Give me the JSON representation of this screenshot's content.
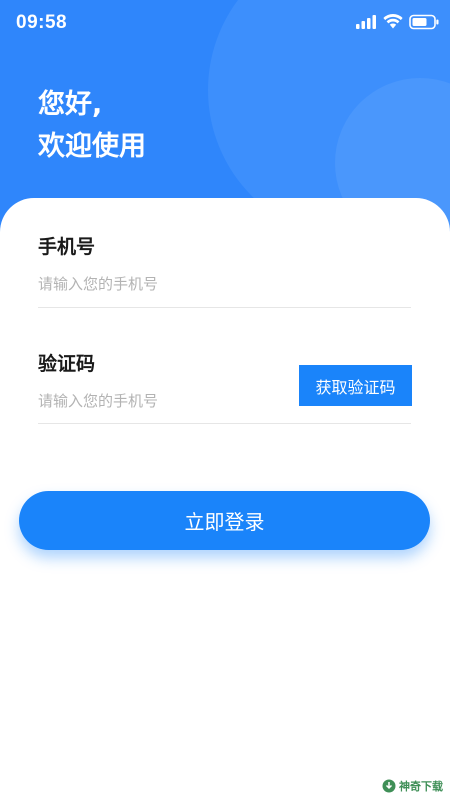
{
  "status_bar": {
    "time": "09:58",
    "icons": [
      "signal-icon",
      "wifi-icon",
      "battery-icon"
    ]
  },
  "header": {
    "greeting_line1": "您好,",
    "greeting_line2": "欢迎使用"
  },
  "form": {
    "phone": {
      "label": "手机号",
      "placeholder": "请输入您的手机号",
      "value": ""
    },
    "code": {
      "label": "验证码",
      "placeholder": "请输入您的手机号",
      "value": "",
      "get_code_label": "获取验证码"
    },
    "login_label": "立即登录"
  },
  "watermark": {
    "text": "神奇下载",
    "icon": "download-logo-icon"
  },
  "colors": {
    "primary": "#1a84fa",
    "header_bg": "#2f86fb",
    "placeholder": "#b3b3b3",
    "divider": "#e6e6e6"
  }
}
